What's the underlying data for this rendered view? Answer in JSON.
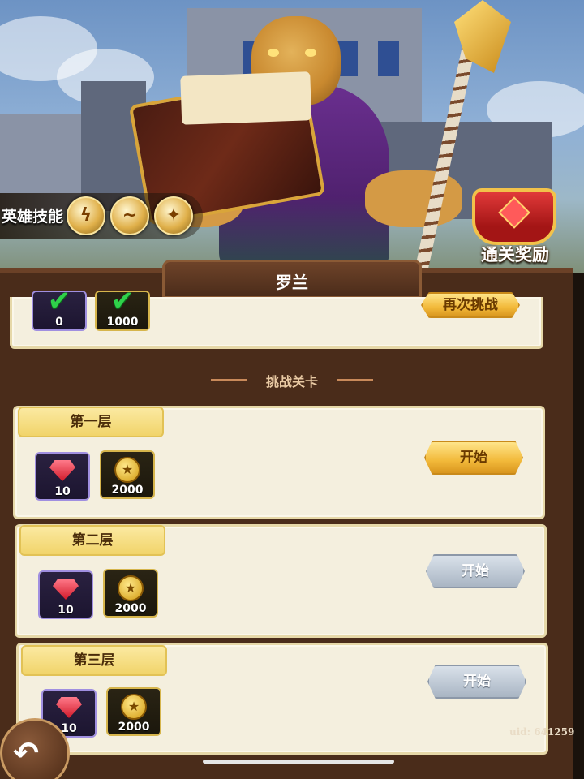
{
  "hero": {
    "name": "罗兰",
    "skills_label": "英雄技能",
    "skills": [
      {
        "icon": "skill-lightning-icon"
      },
      {
        "icon": "skill-swirl-icon"
      },
      {
        "icon": "skill-flame-icon"
      }
    ],
    "clear_reward_label": "通关奖励"
  },
  "completed_rewards": {
    "items": [
      {
        "type": "gem",
        "amount": "0",
        "claimed": true
      },
      {
        "type": "coin",
        "amount": "1000",
        "claimed": true
      }
    ],
    "button_label": "再次挑战"
  },
  "section_title": "挑战关卡",
  "tiers": [
    {
      "label": "第一层",
      "rewards": [
        {
          "type": "gem",
          "amount": "10"
        },
        {
          "type": "coin",
          "amount": "2000"
        }
      ],
      "button_label": "开始",
      "button_state": "active"
    },
    {
      "label": "第二层",
      "rewards": [
        {
          "type": "gem",
          "amount": "10"
        },
        {
          "type": "coin",
          "amount": "2000"
        }
      ],
      "button_label": "开始",
      "button_state": "disabled"
    },
    {
      "label": "第三层",
      "rewards": [
        {
          "type": "gem",
          "amount": "10"
        },
        {
          "type": "coin",
          "amount": "2000"
        }
      ],
      "button_label": "开始",
      "button_state": "disabled"
    }
  ],
  "uid_label": "uid: 641259",
  "colors": {
    "panel_bg": "#4a2c1a",
    "card_bg": "#f4efde",
    "tier_tab": "#f1d46a",
    "button_active": "#f2b93a",
    "button_disabled": "#a9b5c3"
  }
}
